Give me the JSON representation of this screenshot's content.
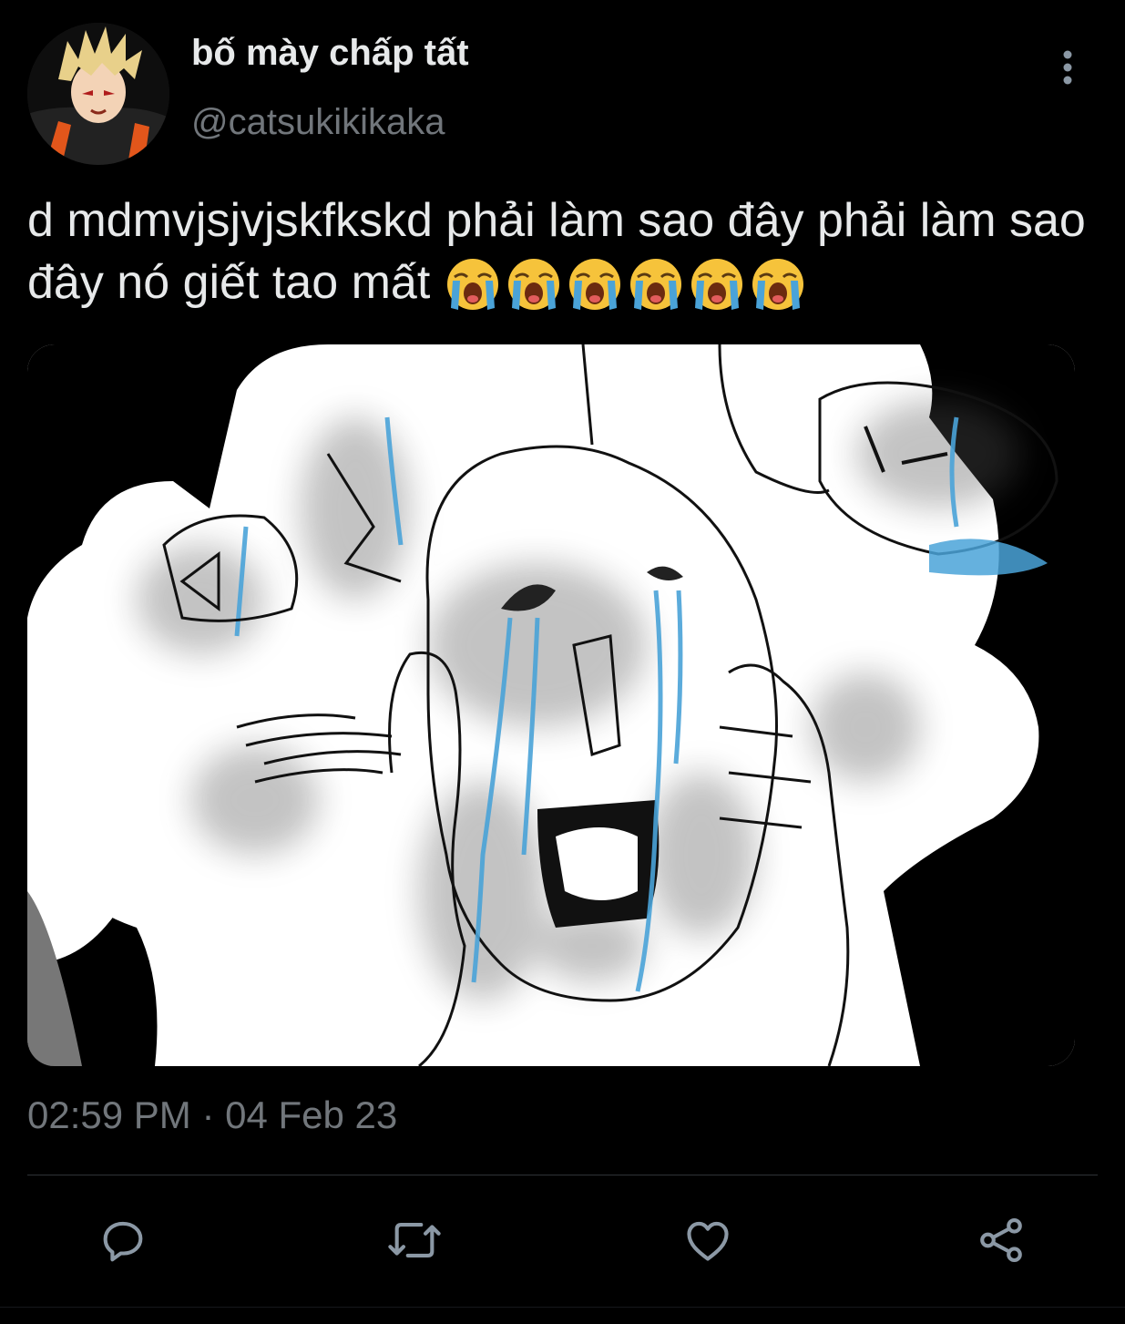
{
  "tweet": {
    "display_name": "bố mày chấp tất",
    "handle": "@catsukikikaka",
    "text": "d mdmvjsjvjskfkskd phải làm sao đây phải làm sao đây nó giết tao mất",
    "emojis": [
      "😭",
      "😭",
      "😭",
      "😭",
      "😭",
      "😭"
    ],
    "timestamp": "02:59 PM · 04 Feb 23"
  },
  "colors": {
    "background": "#000000",
    "name": "#e7e9ea",
    "secondary": "#71767b",
    "icon": "#8b98a5",
    "tear_blue": "#4aa3d8"
  },
  "icons": {
    "more": "more-vertical-icon",
    "reply": "reply-icon",
    "retweet": "retweet-icon",
    "like": "heart-icon",
    "share": "share-icon"
  }
}
